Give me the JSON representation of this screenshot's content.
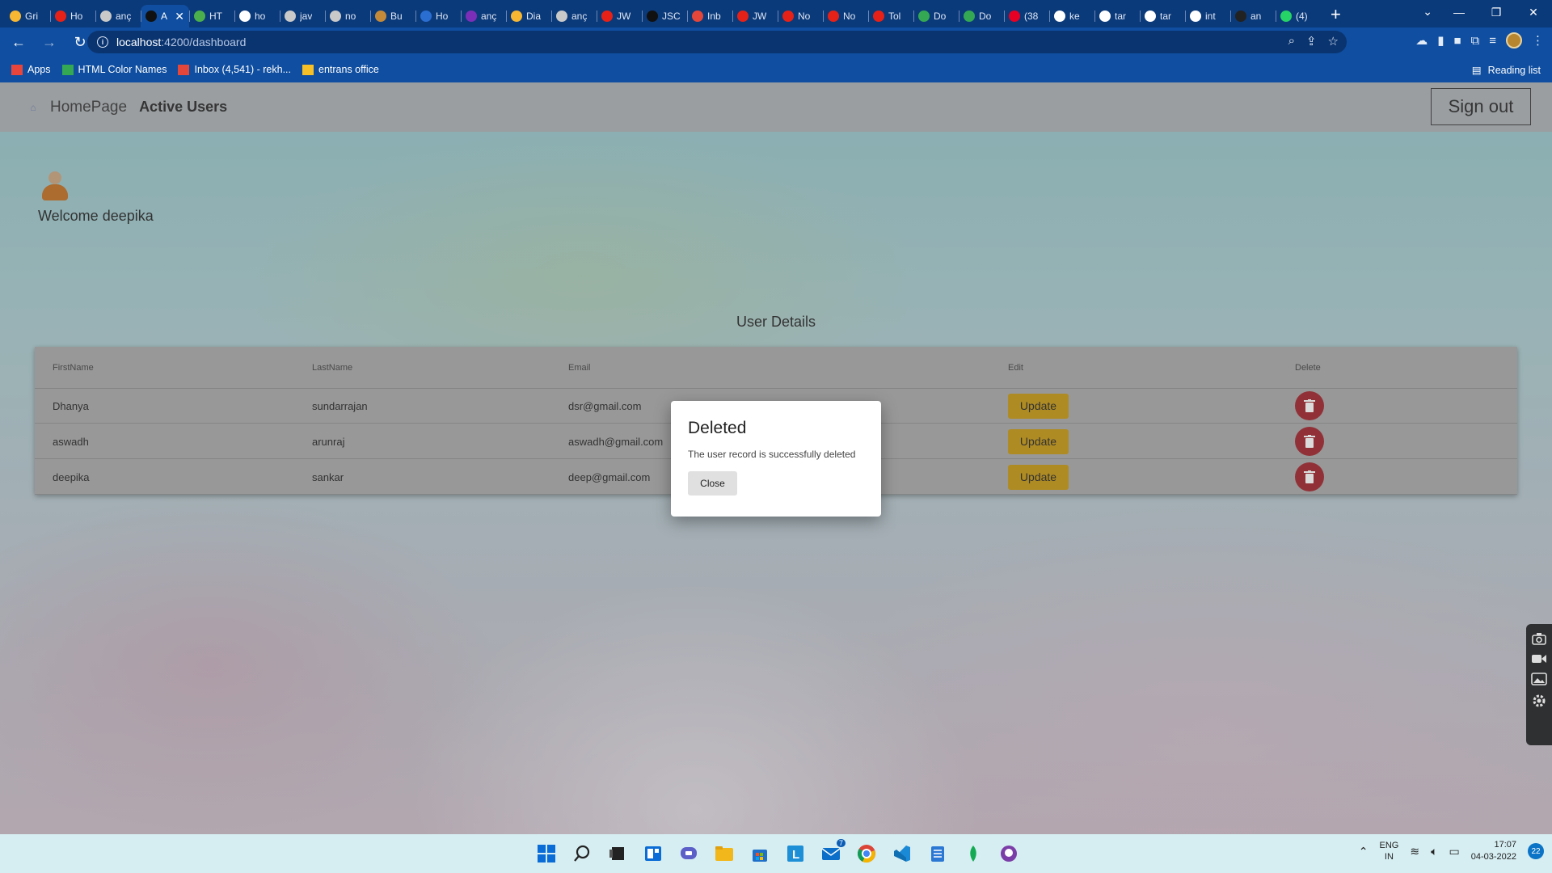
{
  "browser": {
    "tabs": [
      {
        "label": "Gri",
        "color": "#f7b733"
      },
      {
        "label": "Ho",
        "color": "#e62117"
      },
      {
        "label": "anç",
        "color": "#c9c9c9"
      },
      {
        "label": "A",
        "color": "#111111",
        "active": true
      },
      {
        "label": "HT",
        "color": "#4bb04b"
      },
      {
        "label": "ho",
        "color": "#ffffff"
      },
      {
        "label": "jav",
        "color": "#c9c9c9"
      },
      {
        "label": "no",
        "color": "#c9c9c9"
      },
      {
        "label": "Bu",
        "color": "#c48a3a"
      },
      {
        "label": "Ho",
        "color": "#2a6ed1"
      },
      {
        "label": "anç",
        "color": "#7b2fb8"
      },
      {
        "label": "Dia",
        "color": "#f7b733"
      },
      {
        "label": "anç",
        "color": "#c9c9c9"
      },
      {
        "label": "JW",
        "color": "#e62117"
      },
      {
        "label": "JSC",
        "color": "#111111"
      },
      {
        "label": "Inb",
        "color": "#e5463a"
      },
      {
        "label": "JW",
        "color": "#e62117"
      },
      {
        "label": "No",
        "color": "#e62117"
      },
      {
        "label": "No",
        "color": "#e62117"
      },
      {
        "label": "Tol",
        "color": "#e62117"
      },
      {
        "label": "Do",
        "color": "#34a853"
      },
      {
        "label": "Do",
        "color": "#34a853"
      },
      {
        "label": "(38",
        "color": "#e60023"
      },
      {
        "label": "ke",
        "color": "#ffffff"
      },
      {
        "label": "tar",
        "color": "#ffffff"
      },
      {
        "label": "tar",
        "color": "#ffffff"
      },
      {
        "label": "int",
        "color": "#ffffff"
      },
      {
        "label": "an",
        "color": "#222222"
      },
      {
        "label": "(4)",
        "color": "#25d366"
      }
    ],
    "active_tab_close": "✕",
    "new_tab": "+",
    "address": {
      "host": "localhost",
      "path": ":4200/dashboard"
    },
    "bookmarks": [
      {
        "label": "Apps",
        "color": "#e8453c"
      },
      {
        "label": "HTML Color Names",
        "color": "#34a853"
      },
      {
        "label": "Inbox (4,541) - rekh...",
        "color": "#e5463a"
      },
      {
        "label": "entrans office",
        "color": "#f6c026"
      }
    ],
    "reading_list": "Reading list"
  },
  "app": {
    "brand": "HomePage",
    "nav_active": "Active Users",
    "sign_out": "Sign out",
    "welcome": "Welcome deepika",
    "section_title": "User Details",
    "table": {
      "headers": [
        "FirstName",
        "LastName",
        "Email",
        "Edit",
        "Delete"
      ],
      "rows": [
        {
          "first": "Dhanya",
          "last": "sundarrajan",
          "email": "dsr@gmail.com"
        },
        {
          "first": "aswadh",
          "last": "arunraj",
          "email": "aswadh@gmail.com"
        },
        {
          "first": "deepika",
          "last": "sankar",
          "email": "deep@gmail.com"
        }
      ],
      "update_label": "Update"
    },
    "dialog": {
      "title": "Deleted",
      "message": "The user record is successfully deleted",
      "close": "Close"
    }
  },
  "taskbar": {
    "language": "ENG",
    "region": "IN",
    "time": "17:07",
    "date": "04-03-2022",
    "notifications": "22",
    "mail_badge": "7"
  }
}
